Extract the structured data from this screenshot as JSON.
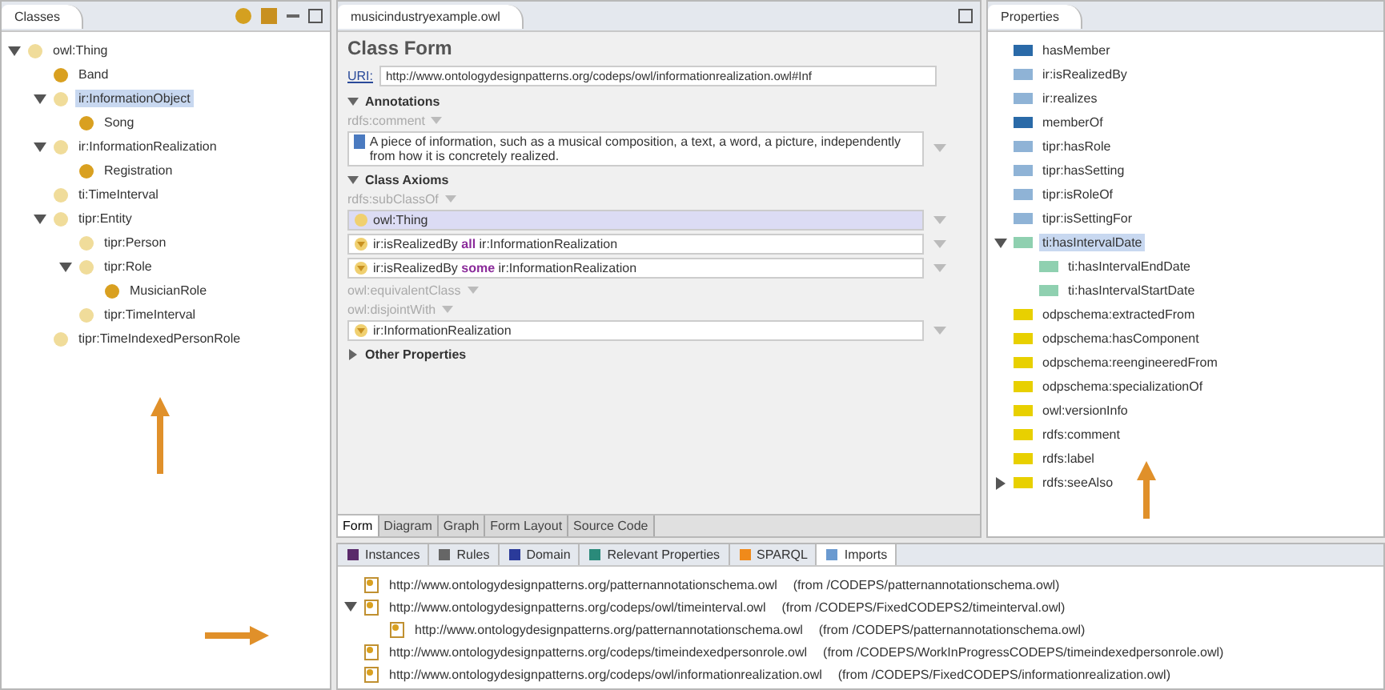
{
  "classes_view": {
    "tab": "Classes",
    "tree": [
      {
        "label": "owl:Thing",
        "imported": true,
        "selected": false,
        "expanded": true,
        "children": [
          {
            "label": "Band",
            "imported": false,
            "selected": false
          },
          {
            "label": "ir:InformationObject",
            "imported": true,
            "selected": true,
            "expanded": true,
            "children": [
              {
                "label": "Song",
                "imported": false,
                "selected": false
              }
            ]
          },
          {
            "label": "ir:InformationRealization",
            "imported": true,
            "selected": false,
            "expanded": true,
            "children": [
              {
                "label": "Registration",
                "imported": false,
                "selected": false
              }
            ]
          },
          {
            "label": "ti:TimeInterval",
            "imported": true,
            "selected": false
          },
          {
            "label": "tipr:Entity",
            "imported": true,
            "selected": false,
            "expanded": true,
            "children": [
              {
                "label": "tipr:Person",
                "imported": true,
                "selected": false
              },
              {
                "label": "tipr:Role",
                "imported": true,
                "selected": false,
                "expanded": true,
                "children": [
                  {
                    "label": "MusicianRole",
                    "imported": false,
                    "selected": false
                  }
                ]
              },
              {
                "label": "tipr:TimeInterval",
                "imported": true,
                "selected": false
              }
            ]
          },
          {
            "label": "tipr:TimeIndexedPersonRole",
            "imported": true,
            "selected": false
          }
        ]
      }
    ]
  },
  "editor": {
    "tab": "musicindustryexample.owl",
    "title": "Class Form",
    "uri_label": "URI:",
    "uri": "http://www.ontologydesignpatterns.org/codeps/owl/informationrealization.owl#Inf",
    "sections": [
      {
        "title": "Annotations",
        "expanded": true,
        "groups": [
          {
            "label": "rdfs:comment",
            "values": [
              {
                "text": "A piece of information, such as a musical composition, a text, a word, a picture, independently from how it is concretely realized.",
                "kind": "annotation",
                "selected": false
              }
            ]
          }
        ]
      },
      {
        "title": "Class Axioms",
        "expanded": true,
        "groups": [
          {
            "label": "rdfs:subClassOf",
            "values": [
              {
                "text": "owl:Thing",
                "kind": "class",
                "selected": true
              },
              {
                "text": "ir:isRealizedBy **all** ir:InformationRealization",
                "kind": "restriction",
                "selected": false
              },
              {
                "text": "ir:isRealizedBy **some** ir:InformationRealization",
                "kind": "restriction",
                "selected": false
              }
            ]
          },
          {
            "label": "owl:equivalentClass"
          },
          {
            "label": "owl:disjointWith",
            "values": [
              {
                "text": "ir:InformationRealization",
                "kind": "restriction",
                "selected": false
              }
            ]
          }
        ]
      },
      {
        "title": "Other Properties",
        "expanded": false
      }
    ],
    "bottom_tabs": [
      {
        "label": "Form",
        "selected": true
      },
      {
        "label": "Diagram",
        "selected": false
      },
      {
        "label": "Graph",
        "selected": false
      },
      {
        "label": "Form Layout",
        "selected": false
      },
      {
        "label": "Source Code",
        "selected": false
      }
    ]
  },
  "properties_view": {
    "tab": "Properties",
    "tree": [
      {
        "label": "hasMember",
        "color": "#2a6aa8"
      },
      {
        "label": "ir:isRealizedBy",
        "color": "#8fb3d6"
      },
      {
        "label": "ir:realizes",
        "color": "#8fb3d6"
      },
      {
        "label": "memberOf",
        "color": "#2a6aa8"
      },
      {
        "label": "tipr:hasRole",
        "color": "#8fb3d6"
      },
      {
        "label": "tipr:hasSetting",
        "color": "#8fb3d6"
      },
      {
        "label": "tipr:isRoleOf",
        "color": "#8fb3d6"
      },
      {
        "label": "tipr:isSettingFor",
        "color": "#8fb3d6"
      },
      {
        "label": "ti:hasIntervalDate",
        "color": "#8fd0b0",
        "selected": true,
        "expanded": true,
        "children": [
          {
            "label": "ti:hasIntervalEndDate",
            "color": "#8fd0b0"
          },
          {
            "label": "ti:hasIntervalStartDate",
            "color": "#8fd0b0"
          }
        ]
      },
      {
        "label": "odpschema:extractedFrom",
        "color": "#e8d000"
      },
      {
        "label": "odpschema:hasComponent",
        "color": "#e8d000"
      },
      {
        "label": "odpschema:reengineeredFrom",
        "color": "#e8d000"
      },
      {
        "label": "odpschema:specializationOf",
        "color": "#e8d000"
      },
      {
        "label": "owl:versionInfo",
        "color": "#e8d000"
      },
      {
        "label": "rdfs:comment",
        "color": "#e8d000"
      },
      {
        "label": "rdfs:label",
        "color": "#e8d000"
      },
      {
        "label": "rdfs:seeAlso",
        "color": "#e8d000",
        "expanded": false
      }
    ]
  },
  "bottom_view": {
    "tabs": [
      {
        "label": "Instances",
        "kind": "instances",
        "selected": false
      },
      {
        "label": "Rules",
        "kind": "rules",
        "selected": false
      },
      {
        "label": "Domain",
        "kind": "domain",
        "selected": false
      },
      {
        "label": "Relevant Properties",
        "kind": "relevant",
        "selected": false
      },
      {
        "label": "SPARQL",
        "kind": "sparql",
        "selected": false
      },
      {
        "label": "Imports",
        "kind": "imports",
        "selected": true
      }
    ],
    "imports": [
      {
        "url": "http://www.ontologydesignpatterns.org/patternannotationschema.owl",
        "source": "(from /CODEPS/patternannotationschema.owl)"
      },
      {
        "url": "http://www.ontologydesignpatterns.org/codeps/owl/timeinterval.owl",
        "source": "(from /CODEPS/FixedCODEPS2/timeinterval.owl)",
        "expanded": true,
        "children": [
          {
            "url": "http://www.ontologydesignpatterns.org/patternannotationschema.owl",
            "source": "(from /CODEPS/patternannotationschema.owl)"
          }
        ]
      },
      {
        "url": "http://www.ontologydesignpatterns.org/codeps/timeindexedpersonrole.owl",
        "source": "(from /CODEPS/WorkInProgressCODEPS/timeindexedpersonrole.owl)"
      },
      {
        "url": "http://www.ontologydesignpatterns.org/codeps/owl/informationrealization.owl",
        "source": "(from /CODEPS/FixedCODEPS/informationrealization.owl)"
      }
    ]
  }
}
